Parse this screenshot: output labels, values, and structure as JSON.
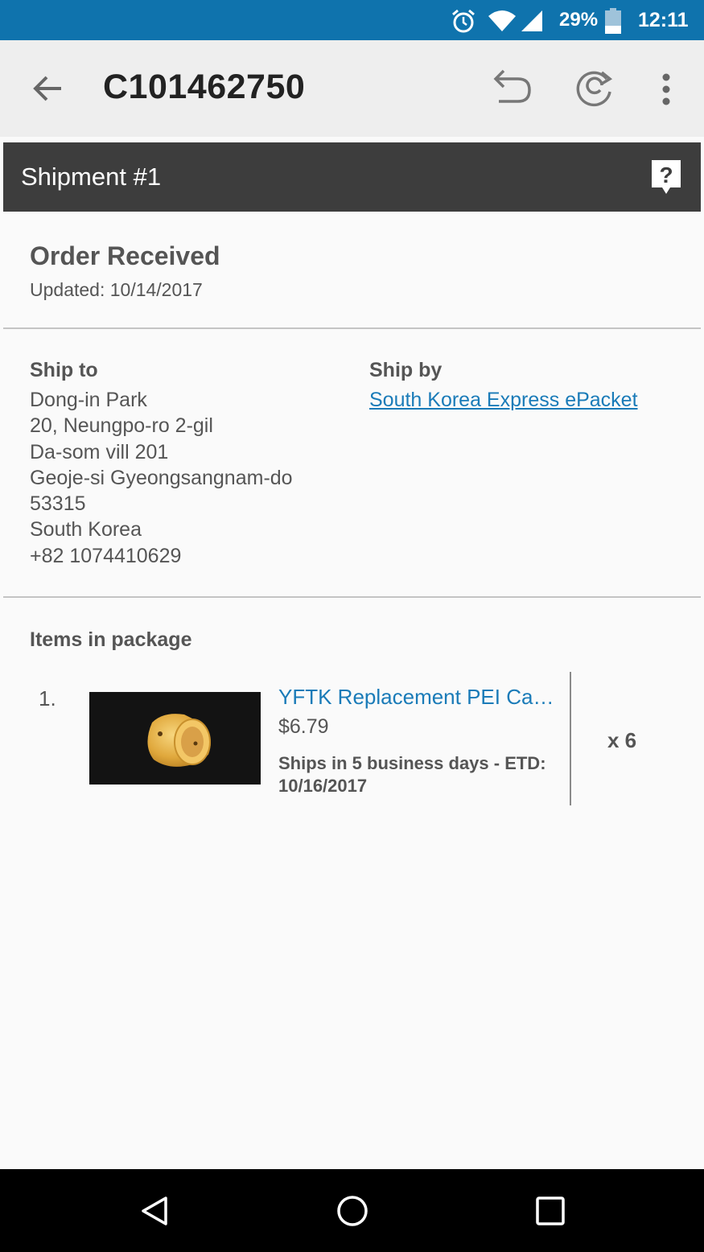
{
  "status_bar": {
    "battery_percent": "29%",
    "time": "12:11",
    "icons": [
      "alarm-icon",
      "wifi-icon",
      "cell-signal-icon",
      "battery-icon"
    ]
  },
  "app_bar": {
    "title": "C101462750",
    "icons": [
      "back-arrow-icon",
      "undo-return-icon",
      "refresh-icon",
      "more-vert-icon"
    ]
  },
  "shipment": {
    "title": "Shipment #1",
    "help_icon": "help-question-icon"
  },
  "order_status": {
    "title": "Order Received",
    "updated": "Updated: 10/14/2017"
  },
  "ship_to": {
    "heading": "Ship to",
    "lines": [
      "Dong-in Park",
      "20, Neungpo-ro 2-gil",
      "Da-som vill 201",
      "Geoje-si Gyeongsangnam-do",
      "53315",
      "South Korea",
      "+82 1074410629"
    ]
  },
  "ship_by": {
    "heading": "Ship by",
    "carrier": "South Korea Express ePacket"
  },
  "items": {
    "heading": "Items in package",
    "list": [
      {
        "number": "1.",
        "name": "YFTK Replacement PEI Cap…",
        "price": "$6.79",
        "ships": "Ships in 5 business days - ETD: 10/16/2017",
        "quantity": "x 6"
      }
    ]
  },
  "nav_bar": {
    "icons": [
      "nav-back-icon",
      "nav-home-icon",
      "nav-recents-icon"
    ]
  },
  "colors": {
    "status_bar": "#0f73ad",
    "app_bar": "#eeeeee",
    "shipment_header": "#3d3d3d",
    "link": "#1a7bb8",
    "text": "#555555"
  }
}
